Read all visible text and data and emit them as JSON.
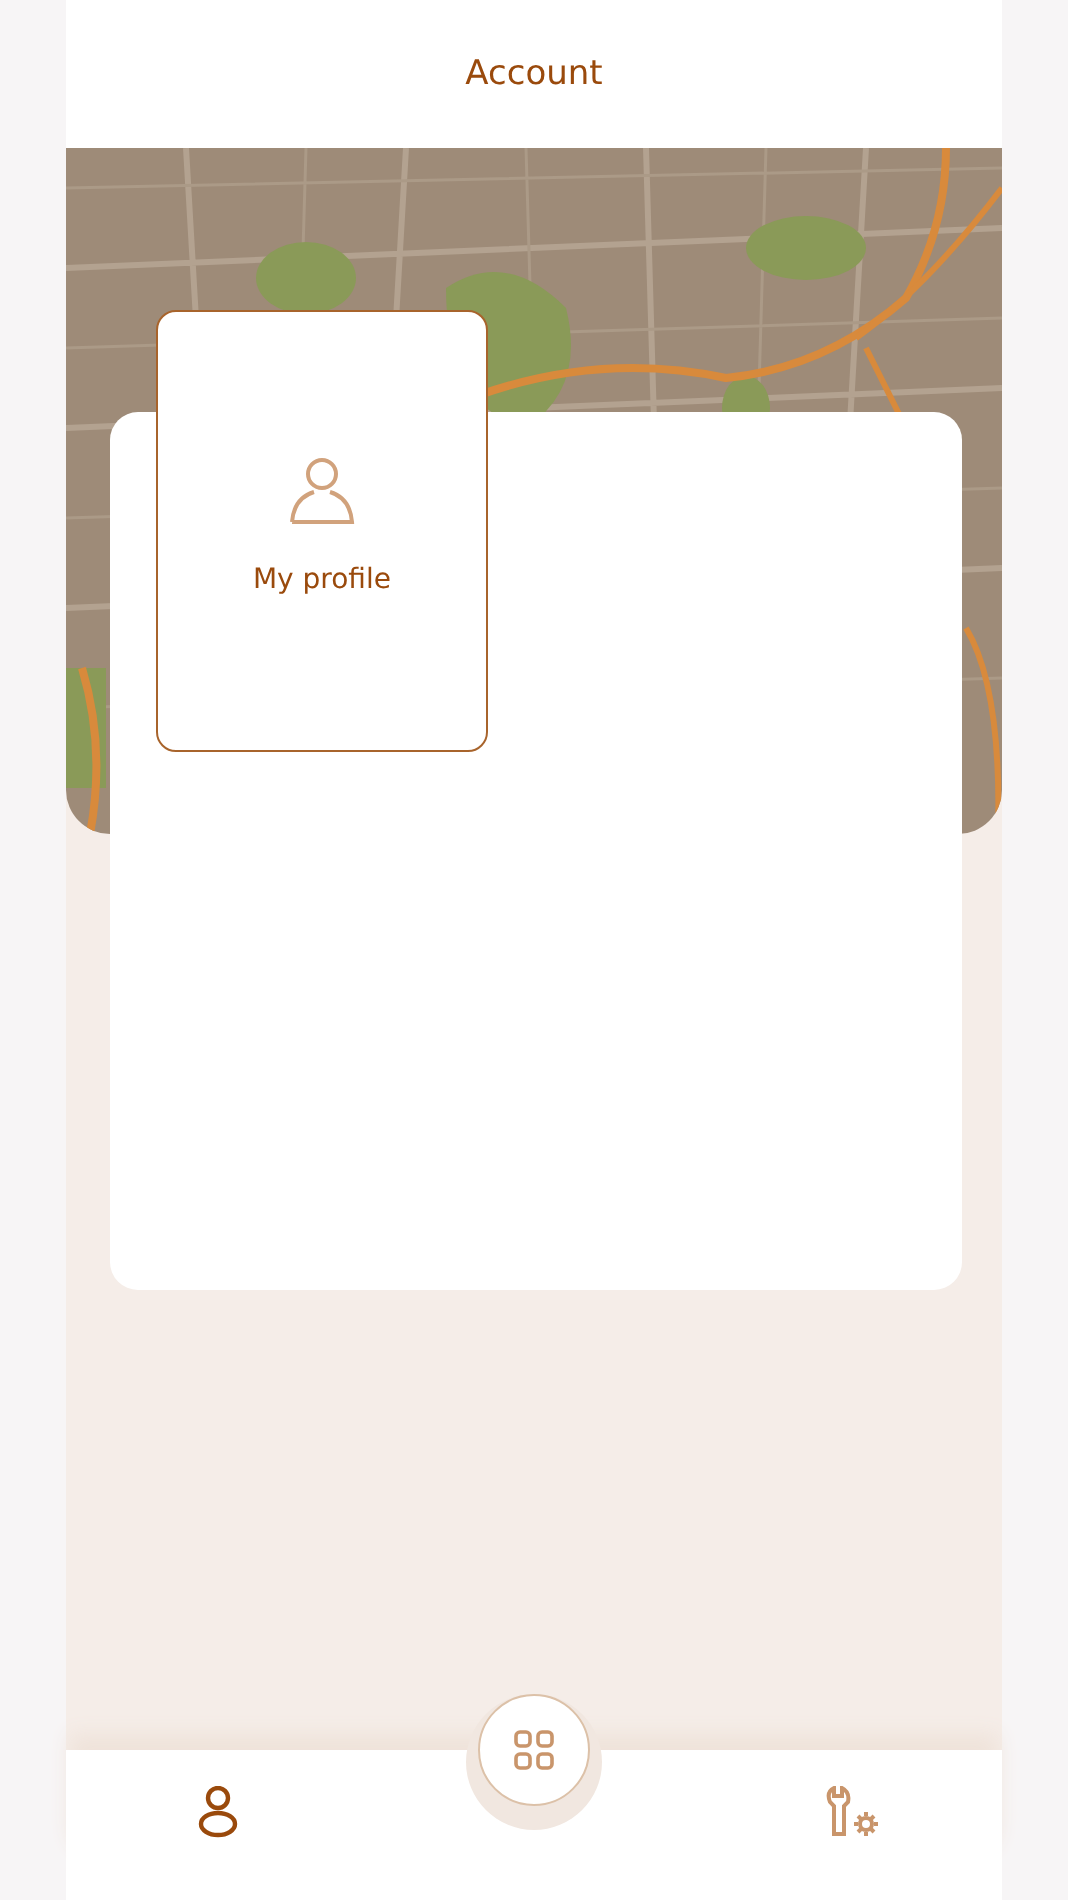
{
  "header": {
    "title": "Account"
  },
  "menu_cards": [
    {
      "label": "My profile",
      "kind": "profile"
    }
  ],
  "bottom_nav": [
    {
      "kind": "profile",
      "selected": true
    },
    {
      "kind": "apps",
      "selected": false
    },
    {
      "kind": "tools",
      "selected": false
    }
  ]
}
